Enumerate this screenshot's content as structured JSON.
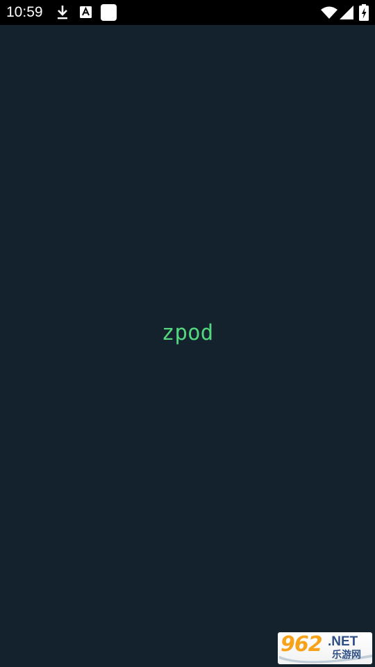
{
  "status_bar": {
    "time": "10:59",
    "icons": {
      "left": [
        "download-icon",
        "a-box-icon",
        "blank-square-icon"
      ],
      "right": [
        "wifi-icon",
        "cell-signal-icon",
        "battery-charging-icon"
      ]
    }
  },
  "app": {
    "name": "zpod",
    "background_color": "#14222d",
    "accent_color": "#53d67e"
  },
  "watermark": {
    "number": "962",
    "suffix": ".NET",
    "cn_text": "乐游网"
  }
}
